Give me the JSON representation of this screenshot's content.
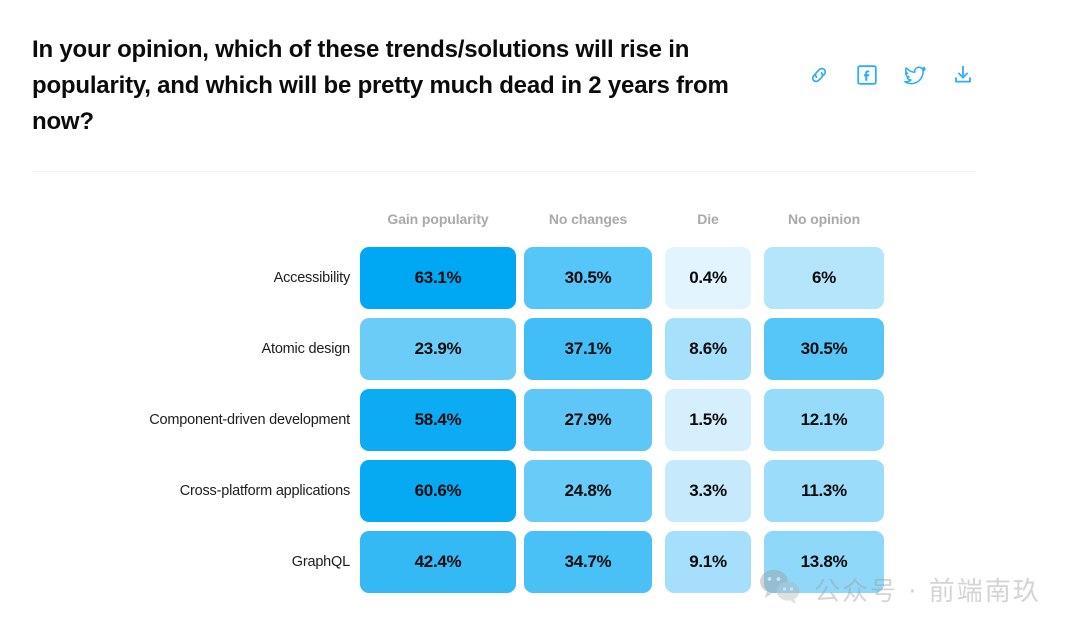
{
  "header": {
    "question": "In your opinion, which of these trends/solutions will rise in popularity, and which will be pretty much dead in 2 years from now?",
    "share": [
      {
        "name": "link-icon",
        "label": "Copy link"
      },
      {
        "name": "facebook-icon",
        "label": "Share on Facebook"
      },
      {
        "name": "twitter-icon",
        "label": "Share on Twitter"
      },
      {
        "name": "download-icon",
        "label": "Download"
      }
    ],
    "accent_color": "#2eadf5"
  },
  "watermark": {
    "text": "公众号 · 前端南玖",
    "icon": "wechat-icon"
  },
  "chart_data": {
    "type": "heatmap",
    "title": "In your opinion, which of these trends/solutions will rise in popularity, and which will be pretty much dead in 2 years from now?",
    "xlabel": "",
    "ylabel": "",
    "categories": [
      "Gain popularity",
      "No changes",
      "Die",
      "No opinion"
    ],
    "rows": [
      "Accessibility",
      "Atomic design",
      "Component-driven development",
      "Cross-platform applications",
      "GraphQL"
    ],
    "unit": "%",
    "values": [
      [
        63.1,
        30.5,
        0.4,
        6
      ],
      [
        23.9,
        37.1,
        8.6,
        30.5
      ],
      [
        58.4,
        27.9,
        1.5,
        12.1
      ],
      [
        60.6,
        24.8,
        3.3,
        11.3
      ],
      [
        42.4,
        34.7,
        9.1,
        13.8
      ]
    ],
    "labels": [
      [
        "63.1%",
        "30.5%",
        "0.4%",
        "6%"
      ],
      [
        "23.9%",
        "37.1%",
        "8.6%",
        "30.5%"
      ],
      [
        "58.4%",
        "27.9%",
        "1.5%",
        "12.1%"
      ],
      [
        "60.6%",
        "24.8%",
        "3.3%",
        "11.3%"
      ],
      [
        "42.4%",
        "34.7%",
        "9.1%",
        "13.8%"
      ]
    ],
    "colorscale": {
      "min_value": 0,
      "max_value": 63.1,
      "low_color": "#ecf7fe",
      "high_color": "#00a8f3"
    },
    "grid": false,
    "legend": "none"
  }
}
